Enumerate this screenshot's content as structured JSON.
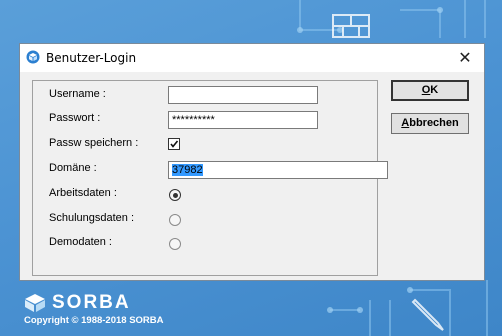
{
  "dialog": {
    "title": "Benutzer-Login",
    "close_symbol": "✕"
  },
  "form": {
    "username": {
      "label": "Username :",
      "value": ""
    },
    "password": {
      "label": "Passwort :",
      "value": "**********"
    },
    "save_password": {
      "label": "Passw speichern :",
      "checked": true
    },
    "domain": {
      "label": "Domäne :",
      "value": "37982"
    },
    "data_options": [
      {
        "label": "Arbeitsdaten :",
        "selected": true
      },
      {
        "label": "Schulungsdaten :",
        "selected": false
      },
      {
        "label": "Demodaten :",
        "selected": false
      }
    ]
  },
  "buttons": {
    "ok": {
      "mnemonic": "O",
      "rest": "K"
    },
    "cancel": {
      "mnemonic": "A",
      "rest": "bbrechen"
    }
  },
  "branding": {
    "logo_text": "SORBA",
    "copyright": "Copyright © 1988-2018 SORBA"
  },
  "colors": {
    "background": "#4c93d3",
    "selection": "#3399ff",
    "dialog": "#f0f0f0"
  }
}
